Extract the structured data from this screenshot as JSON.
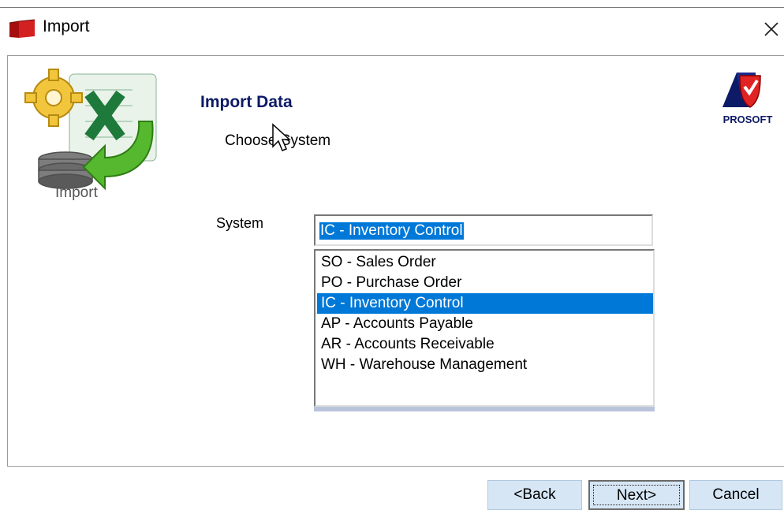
{
  "window": {
    "title": "Import"
  },
  "header": {
    "heading": "Import Data",
    "subheading": "Choose System",
    "import_image_caption": "Import",
    "logo_text": "PROSOFT"
  },
  "form": {
    "system_label": "System",
    "selected_value": "IC - Inventory Control",
    "options": [
      "SO - Sales Order",
      "PO - Purchase Order",
      "IC - Inventory Control",
      "AP - Accounts Payable",
      "AR - Accounts Receivable",
      "WH - Warehouse Management"
    ],
    "selected_index": 2
  },
  "buttons": {
    "back": "<Back",
    "next": "Next>",
    "cancel": "Cancel"
  },
  "colors": {
    "selection": "#0078d7",
    "heading": "#0d1a66",
    "button_bg": "#d6e6f5"
  },
  "icons": [
    "app-icon",
    "close-icon",
    "import-image",
    "prosoft-logo",
    "mouse-cursor-icon"
  ]
}
